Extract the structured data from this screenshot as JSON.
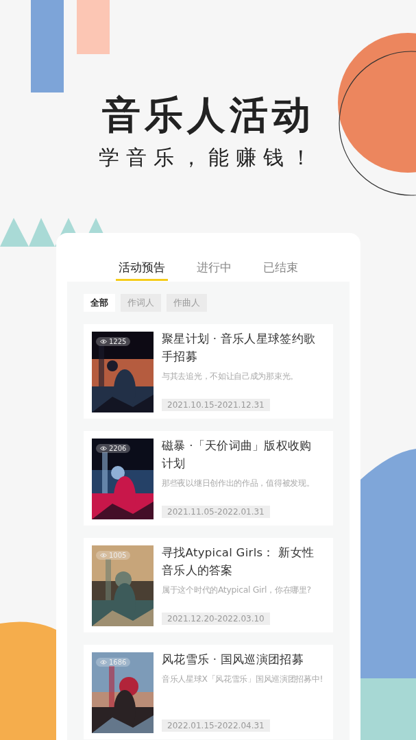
{
  "headline": "音乐人活动",
  "subtitle": "学音乐，能赚钱！",
  "tabs": [
    {
      "label": "活动预告",
      "selected": true
    },
    {
      "label": "进行中",
      "selected": false
    },
    {
      "label": "已结束",
      "selected": false
    }
  ],
  "filters": [
    {
      "label": "全部",
      "selected": true
    },
    {
      "label": "作词人",
      "selected": false
    },
    {
      "label": "作曲人",
      "selected": false
    }
  ],
  "events": [
    {
      "views": "1225",
      "title": "聚星计划 · 音乐人星球签约歌手招募",
      "description": "与其去追光，不如让自己成为那束光。",
      "dates": "2021.10.15-2021.12.31"
    },
    {
      "views": "2206",
      "title": "磁暴 ·「天价词曲」版权收购计划",
      "description": "那些夜以继日创作出的作品，值得被发现。",
      "dates": "2021.11.05-2022.01.31"
    },
    {
      "views": "1005",
      "title": "寻找Atypical Girls： 新女性音乐人的答案",
      "description": "属于这个时代的Atypical Girl，你在哪里?",
      "dates": "2021.12.20-2022.03.10"
    },
    {
      "views": "1686",
      "title": "风花雪乐 · 国风巡演团招募",
      "description": "音乐人星球X「风花雪乐」国风巡演团招募中!",
      "dates": "2022.01.15-2022.04.31"
    }
  ]
}
